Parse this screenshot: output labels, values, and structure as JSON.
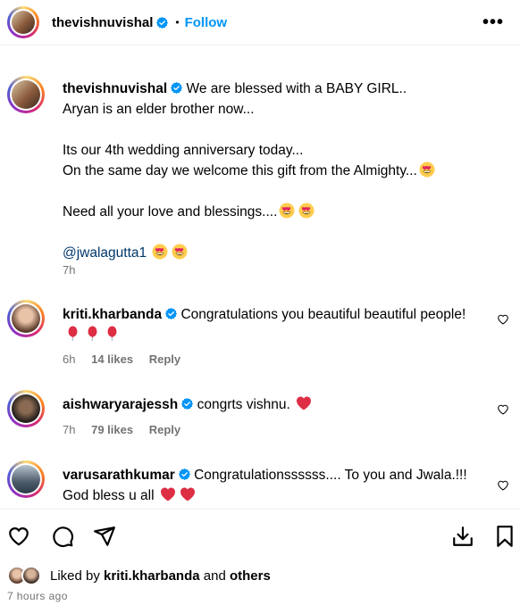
{
  "header": {
    "username": "thevishnuvishal",
    "dot": "•",
    "follow_label": "Follow",
    "more_label": "•••"
  },
  "caption": {
    "username": "thevishnuvishal",
    "line1": "We are blessed with a BABY GIRL..",
    "line2": "Aryan is an elder brother now...",
    "line3": "Its our 4th wedding anniversary today...",
    "line4": "On the same day we welcome this gift from the Almighty...",
    "line5": "Need all your love and blessings....",
    "mention": "@jwalagutta1",
    "time": "7h"
  },
  "comments": [
    {
      "username": "kriti.kharbanda",
      "text": "Congratulations you beautiful beautiful people!",
      "time": "6h",
      "likes": "14 likes",
      "reply": "Reply"
    },
    {
      "username": "aishwaryarajessh",
      "text": "congrts vishnu.",
      "time": "7h",
      "likes": "79 likes",
      "reply": "Reply"
    },
    {
      "username": "varusarathkumar",
      "text": "Congratulationssssss.... To you and Jwala.!!! God bless u all"
    }
  ],
  "likes_bar": {
    "prefix": "Liked by",
    "user": "kriti.kharbanda",
    "and": "and",
    "others": "others"
  },
  "post_time": "7 hours ago",
  "colors": {
    "accent": "#0095f6",
    "verified": "#0095f6",
    "mention": "#00376b",
    "meta": "#737373",
    "heart_red": "#e0245e"
  },
  "icons": {
    "verified": "verified-badge-icon",
    "like": "heart-icon",
    "comment": "comment-icon",
    "share": "share-icon",
    "save": "bookmark-icon",
    "download": "download-icon"
  }
}
